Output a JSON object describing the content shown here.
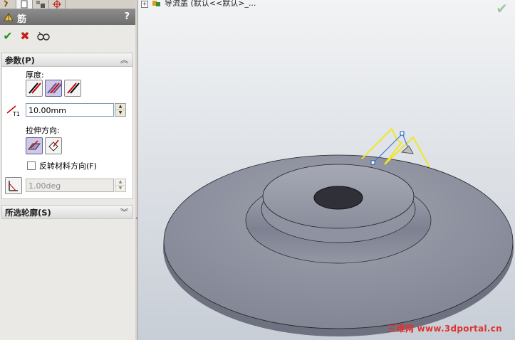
{
  "property_manager": {
    "tabs": [
      "feature-manager-tab",
      "property-manager-tab",
      "configuration-manager-tab",
      "dimxpert-tab"
    ],
    "title": "筋",
    "help": "?",
    "actions": {
      "ok_icon": "checkmark-icon",
      "cancel_icon": "close-icon",
      "preview_icon": "glasses-icon"
    },
    "parameters": {
      "header": "参数(P)",
      "thickness_label": "厚度:",
      "thickness_selected": "both-sides",
      "thickness_value": "10.00mm",
      "extrude_direction_label": "拉伸方向:",
      "extrude_direction_selected": "parallel-to-sketch",
      "flip_material_label": "反转材料方向(F)",
      "flip_material_checked": false,
      "draft_value": "1.00deg",
      "draft_enabled": false
    },
    "selected_contours": {
      "header": "所选轮廓(S)"
    }
  },
  "viewport": {
    "tree_item": "导流盖  (默认<<默认>_...",
    "confirm_icon": "checkmark-icon",
    "watermark": "三维网 www.3dportal.cn"
  },
  "colors": {
    "panel_bg": "#ebe9e6",
    "title_bar": "#7a7a7a",
    "model_body": "#8e919e",
    "rib_sketch": "#f0e628",
    "accent_green": "#1f9a1f",
    "accent_red": "#c81e1e"
  }
}
